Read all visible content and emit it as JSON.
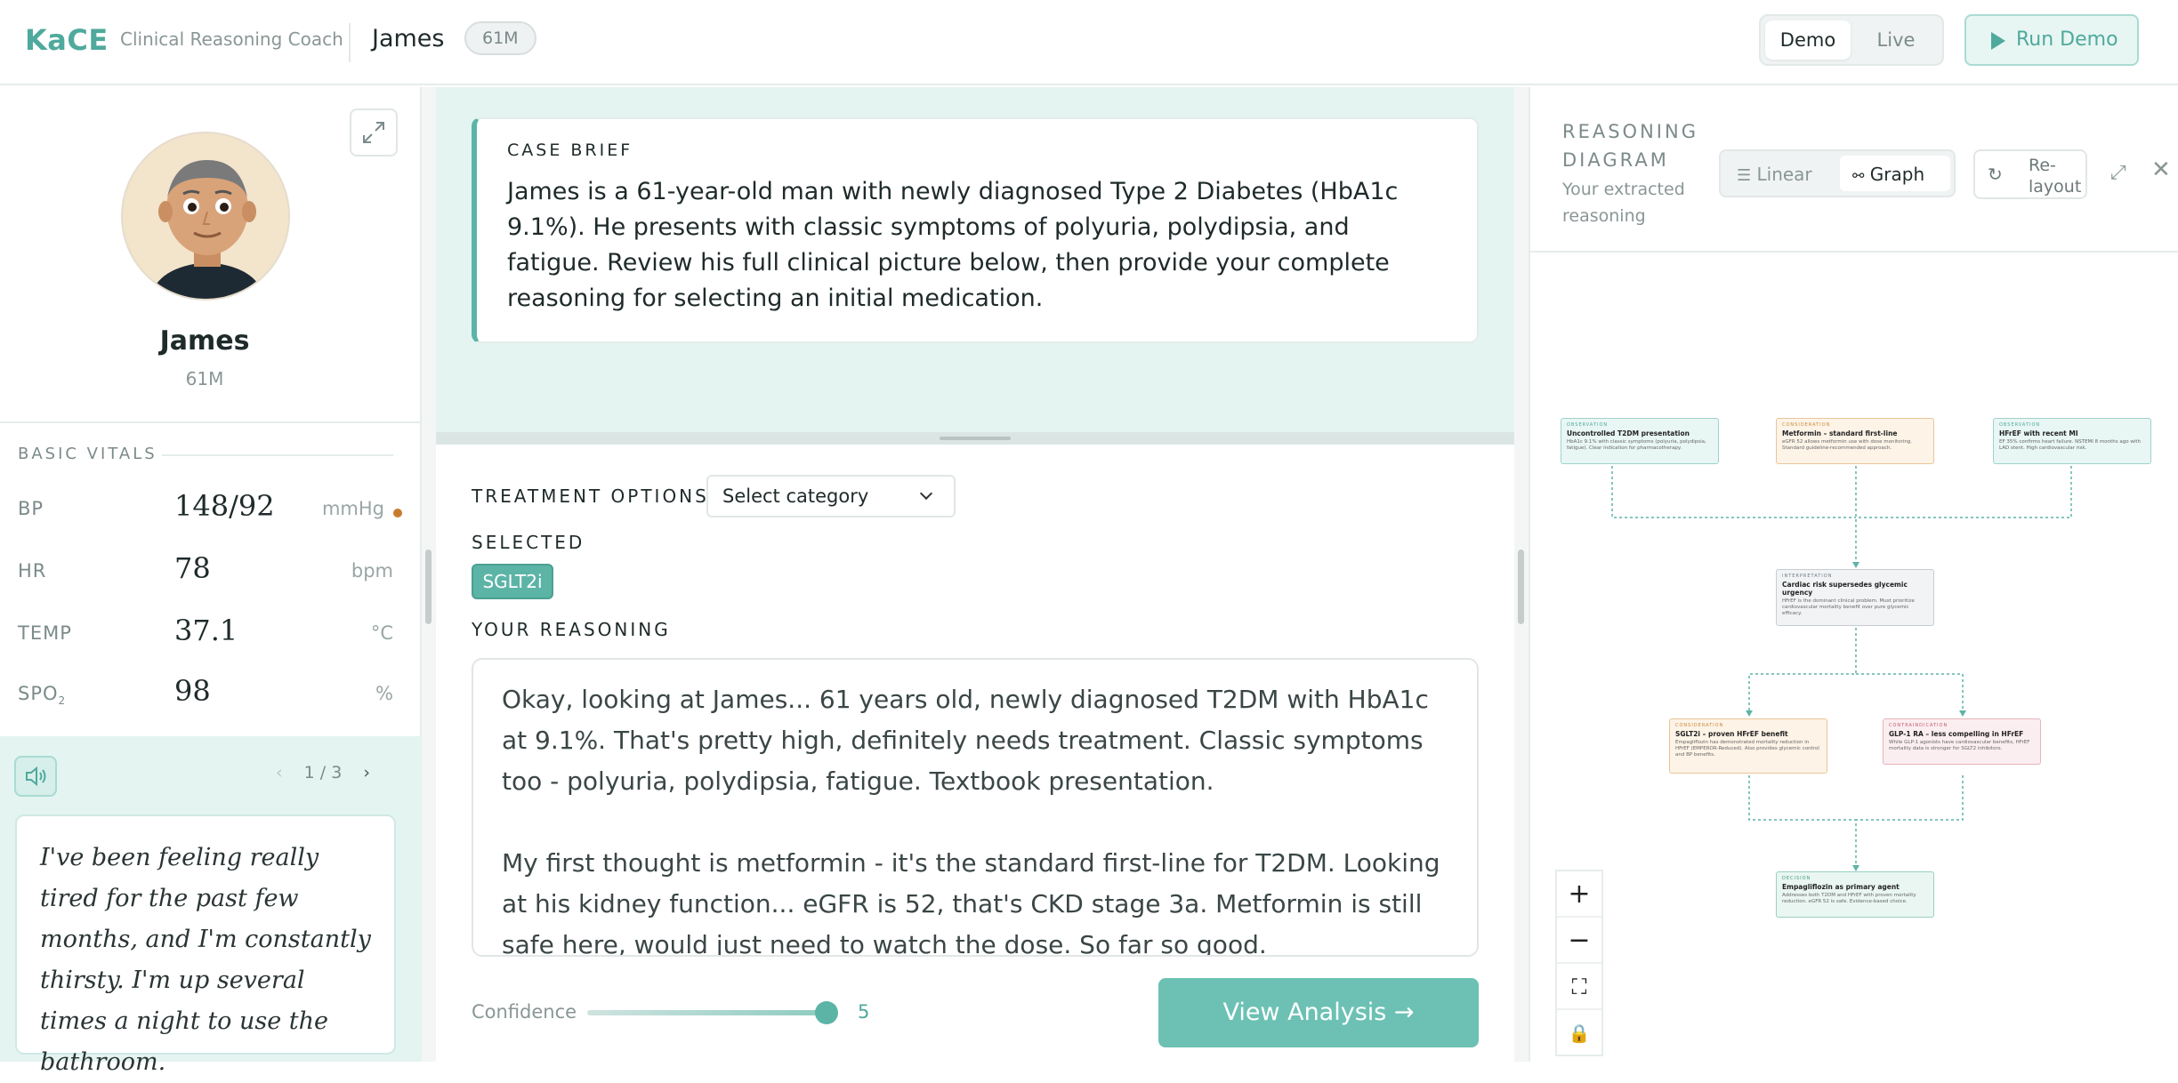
{
  "header": {
    "logo": "KaCE",
    "app_subtitle": "Clinical Reasoning Coach",
    "patient_name": "James",
    "patient_badge": "61M",
    "mode_options": [
      "Demo",
      "Live"
    ],
    "active_mode": "Demo",
    "run_button": "Run Demo"
  },
  "patient_card": {
    "name": "James",
    "age_sex": "61M",
    "vitals_title": "BASIC VITALS",
    "vitals": [
      {
        "label": "BP",
        "value": "148/92",
        "unit": "mmHg",
        "flagged": true
      },
      {
        "label": "HR",
        "value": "78",
        "unit": "bpm"
      },
      {
        "label": "TEMP",
        "value": "37.1",
        "unit": "°C"
      },
      {
        "label": "SPO",
        "sub": "2",
        "value": "98",
        "unit": "%"
      }
    ]
  },
  "patient_quote": {
    "page": "1 / 3",
    "text": "I've been feeling really tired for the past few months, and I'm constantly thirsty. I'm up several times a night to use the bathroom."
  },
  "case_brief": {
    "title": "CASE BRIEF",
    "text": "James is a 61-year-old man with newly diagnosed Type 2 Diabetes (HbA1c 9.1%). He presents with classic symptoms of polyuria, polydipsia, and fatigue. Review his full clinical picture below, then provide your complete reasoning for selecting an initial medication."
  },
  "treatment": {
    "options_label": "TREATMENT OPTIONS",
    "select_value": "Select category",
    "selected_label": "SELECTED",
    "selected_chips": [
      "SGLT2i"
    ],
    "reasoning_label": "YOUR REASONING",
    "reasoning_text": "Okay, looking at James... 61 years old, newly diagnosed T2DM with HbA1c at 9.1%. That's pretty high, definitely needs treatment. Classic symptoms too - polyuria, polydipsia, fatigue. Textbook presentation.\n\nMy first thought is metformin - it's the standard first-line for T2DM. Looking at his kidney function... eGFR is 52, that's CKD stage 3a. Metformin is still safe here, would just need to watch the dose. So far so good.",
    "confidence_label": "Confidence",
    "confidence_value": "5",
    "confidence_level": 1.0,
    "view_button": "View Analysis →"
  },
  "diagram": {
    "title": "REASONING DIAGRAM",
    "subtitle": "Your extracted reasoning",
    "view_options": [
      "Linear",
      "Graph"
    ],
    "active_view": "Graph",
    "relayout_label": "Re-layout",
    "nodes": [
      {
        "kind": "OBSERVATION",
        "title": "Uncontrolled T2DM presentation",
        "body": "HbA1c 9.1% with classic symptoms (polyuria, polydipsia, fatigue). Clear indication for pharmacotherapy."
      },
      {
        "kind": "CONSIDERATION",
        "title": "Metformin – standard first-line",
        "body": "eGFR 52 allows metformin use with dose monitoring. Standard guideline-recommended approach."
      },
      {
        "kind": "OBSERVATION",
        "title": "HFrEF with recent MI",
        "body": "EF 35% confirms heart failure. NSTEMI 8 months ago with LAD stent. High cardiovascular risk."
      },
      {
        "kind": "INTERPRETATION",
        "title": "Cardiac risk supersedes glycemic urgency",
        "body": "HFrEF is the dominant clinical problem. Must prioritize cardiovascular mortality benefit over pure glycemic efficacy."
      },
      {
        "kind": "CONSIDERATION",
        "title": "SGLT2i – proven HFrEF benefit",
        "body": "Empagliflozin has demonstrated mortality reduction in HFrEF (EMPEROR-Reduced). Also provides glycemic control and BP benefits."
      },
      {
        "kind": "CONTRAINDICATION",
        "title": "GLP-1 RA – less compelling in HFrEF",
        "body": "While GLP-1 agonists have cardiovascular benefits, HFrEF mortality data is stronger for SGLT2 inhibitors."
      },
      {
        "kind": "DECISION",
        "title": "Empagliflozin as primary agent",
        "body": "Addresses both T2DM and HFrEF with proven mortality reduction. eGFR 52 is safe. Evidence-based choice."
      }
    ],
    "zoom_controls": [
      "+",
      "−",
      "⛶",
      "🔒"
    ]
  }
}
